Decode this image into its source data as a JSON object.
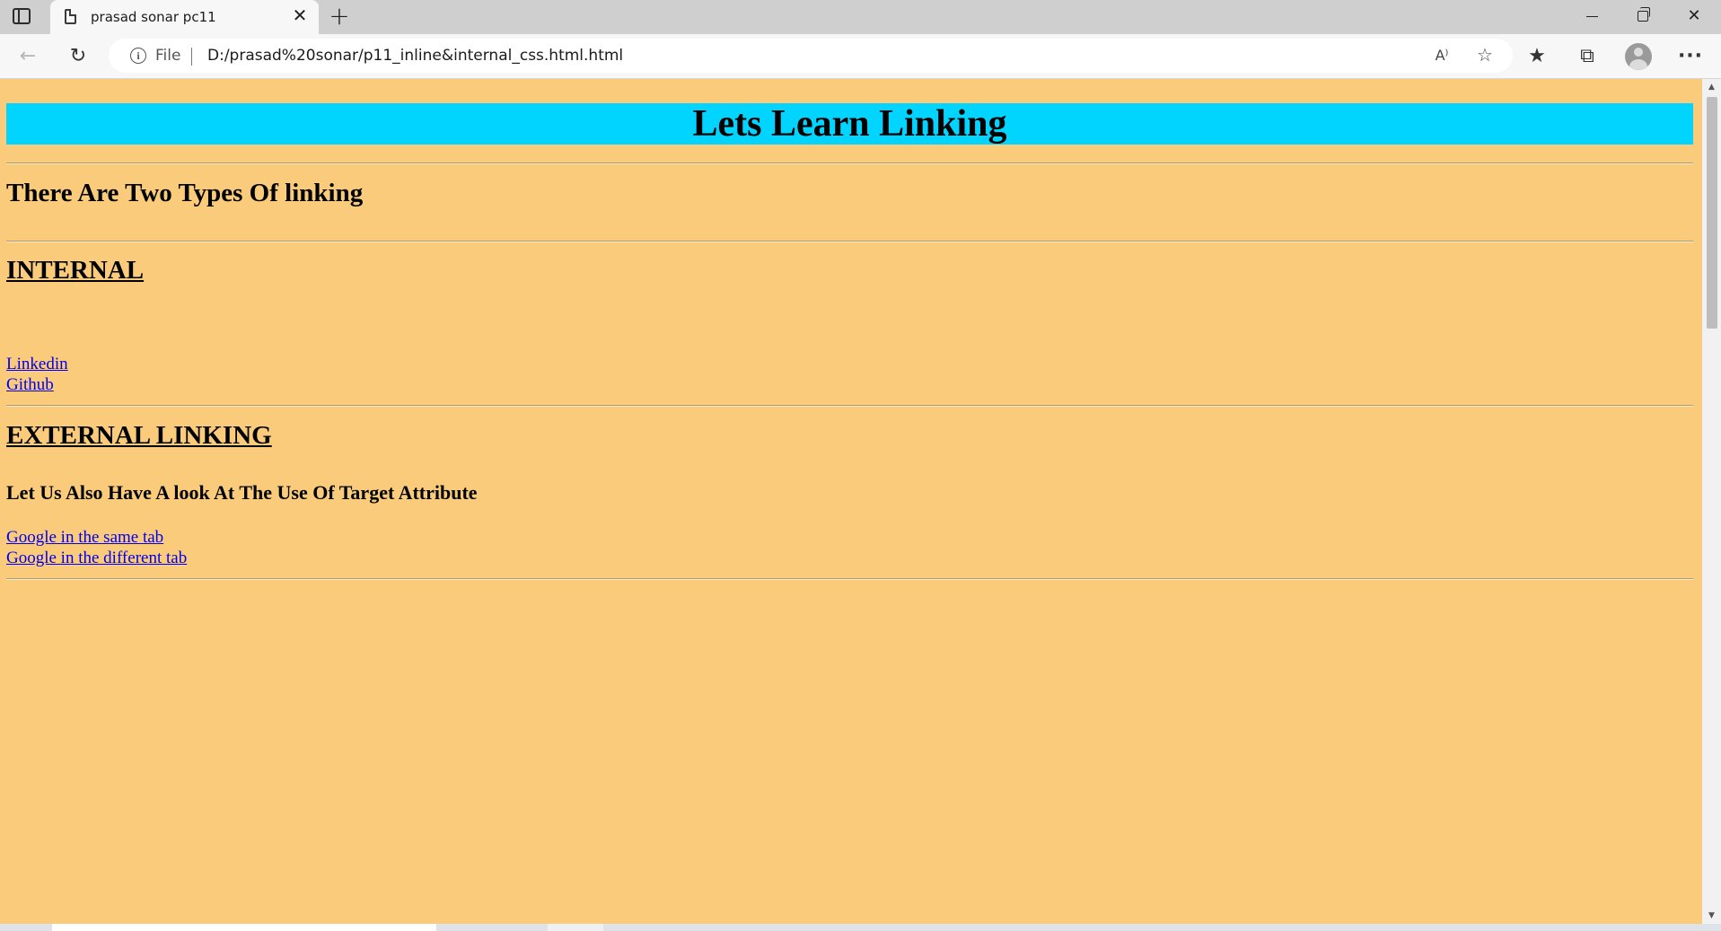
{
  "browser": {
    "tab": {
      "title": "prasad sonar pc11"
    },
    "new_tab_symbol": "+",
    "close_symbol": "✕",
    "address_bar": {
      "scheme_label": "File",
      "url": "D:/prasad%20sonar/p11_inline&internal_css.html.html"
    },
    "read_aloud_symbol": "A⁾",
    "icons": [
      "tab-actions-icon",
      "back-icon",
      "reload-icon",
      "info-icon",
      "read-aloud-icon",
      "add-favorite-icon",
      "favorites-icon",
      "collections-icon",
      "profile-icon",
      "more-icon",
      "minimize-icon",
      "maximize-icon",
      "close-icon"
    ]
  },
  "page": {
    "background_color": "#f9cb7b",
    "banner": {
      "text": "Lets Learn Linking",
      "color": "#00d4ff"
    },
    "intro_heading": "There Are Two Types Of linking",
    "internal": {
      "heading": "INTERNAL",
      "links": [
        "Linkedin",
        "Github"
      ]
    },
    "external": {
      "heading": "EXTERNAL LINKING",
      "subheading": "Let Us Also Have A look At The Use Of Target Attribute",
      "links": [
        "Google in the same tab",
        "Google in the different tab"
      ]
    }
  }
}
